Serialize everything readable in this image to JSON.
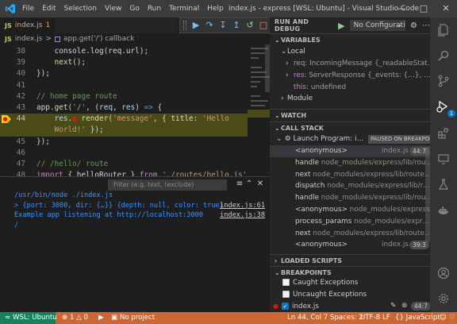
{
  "window": {
    "title": "index.js - express [WSL: Ubuntu] - Visual Studio Code",
    "menu": [
      "File",
      "Edit",
      "Selection",
      "View",
      "Go",
      "Run",
      "Terminal",
      "Help"
    ]
  },
  "editor": {
    "tab": {
      "filename": "index.js",
      "problems": "1"
    },
    "breadcrumb": {
      "file": "index.js",
      "separator": ">",
      "symbol": "app.get('/') callback"
    },
    "current_line": 44,
    "lines": [
      {
        "n": "38",
        "parts": [
          [
            "plain",
            "    console.log(req.url);"
          ]
        ]
      },
      {
        "n": "39",
        "parts": [
          [
            "plain",
            "    "
          ],
          [
            "fn",
            "next"
          ],
          [
            "plain",
            "();"
          ]
        ]
      },
      {
        "n": "40",
        "parts": [
          [
            "plain",
            "});"
          ]
        ]
      },
      {
        "n": "41",
        "parts": [
          [
            "plain",
            ""
          ]
        ]
      },
      {
        "n": "42",
        "parts": [
          [
            "cm",
            "// home page route"
          ]
        ]
      },
      {
        "n": "43",
        "parts": [
          [
            "plain",
            "app."
          ],
          [
            "fn",
            "get"
          ],
          [
            "plain",
            "("
          ],
          [
            "str",
            "'/'"
          ],
          [
            "plain",
            ", ("
          ],
          [
            "var",
            "req"
          ],
          [
            "plain",
            ", "
          ],
          [
            "var",
            "res"
          ],
          [
            "plain",
            ") "
          ],
          [
            "kw2",
            "=>"
          ],
          [
            "plain",
            " {"
          ]
        ]
      },
      {
        "n": "44",
        "parts": [
          [
            "plain",
            "    "
          ],
          [
            "var",
            "res"
          ],
          [
            "plain",
            "."
          ],
          [
            "bp",
            "●"
          ],
          [
            "plain",
            " "
          ],
          [
            "fn",
            "render"
          ],
          [
            "plain",
            "("
          ],
          [
            "str",
            "'message'"
          ],
          [
            "plain",
            ", { title: "
          ],
          [
            "str",
            "'Hello"
          ]
        ]
      },
      {
        "n": "",
        "parts": [
          [
            "str",
            "    World!'"
          ],
          [
            "plain",
            " });"
          ]
        ]
      },
      {
        "n": "45",
        "parts": [
          [
            "plain",
            "});"
          ]
        ]
      },
      {
        "n": "46",
        "parts": [
          [
            "plain",
            ""
          ]
        ]
      },
      {
        "n": "47",
        "parts": [
          [
            "cm",
            "// /hello/ route"
          ]
        ]
      },
      {
        "n": "48",
        "parts": [
          [
            "kw",
            "import"
          ],
          [
            "plain",
            " { helloRouter } "
          ],
          [
            "kw",
            "from"
          ],
          [
            "plain",
            " "
          ],
          [
            "str",
            "'./routes/hello.js'"
          ],
          [
            "plain",
            ";"
          ]
        ]
      },
      {
        "n": "49",
        "parts": [
          [
            "plain",
            "app."
          ],
          [
            "fn",
            "use"
          ],
          [
            "plain",
            "("
          ],
          [
            "str",
            "'/hello'"
          ],
          [
            "plain",
            ", helloRouter);"
          ]
        ]
      }
    ]
  },
  "console": {
    "filter_placeholder": "Filter (e.g. text, !exclude)",
    "lines": [
      {
        "text": "/usr/bin/node ./index.js",
        "color": "#3794ff",
        "ref": ""
      },
      {
        "text": "> {port: 3000, dir: {…}} {depth: null, color: true}",
        "color": "#3794ff",
        "ref": "index.js:61"
      },
      {
        "text": "Example app listening at http://localhost:3000",
        "color": "#3794ff",
        "ref": "index.js:38"
      },
      {
        "text": "/",
        "color": "#3794ff",
        "ref": ""
      }
    ]
  },
  "debug": {
    "run_label": "RUN AND DEBUG",
    "config": "No Configurati",
    "variables": {
      "title": "VARIABLES",
      "local": "Local",
      "items": [
        {
          "name": "req:",
          "value": "IncomingMessage {_readableStat…"
        },
        {
          "name": "res:",
          "value": "ServerResponse {_events: {…}, …"
        },
        {
          "name": "this:",
          "value": "undefined"
        }
      ],
      "module": "Module"
    },
    "watch": "WATCH",
    "call_stack": {
      "title": "CALL STACK",
      "thread": "Launch Program: i…",
      "paused": "PAUSED ON BREAKPOINT",
      "frames": [
        {
          "name": "<anonymous>",
          "src": "",
          "file": "index.js",
          "pos": "44:7",
          "selected": true
        },
        {
          "name": "handle",
          "src": "node_modules/express/lib/rou…",
          "file": "",
          "pos": "",
          "selected": false
        },
        {
          "name": "next",
          "src": "node_modules/express/lib/route…",
          "file": "",
          "pos": "",
          "selected": false
        },
        {
          "name": "dispatch",
          "src": "node_modules/express/lib/r…",
          "file": "",
          "pos": "",
          "selected": false
        },
        {
          "name": "handle",
          "src": "node_modules/express/lib/rou…",
          "file": "",
          "pos": "",
          "selected": false
        },
        {
          "name": "<anonymous>",
          "src": "node_modules/express/li…",
          "file": "",
          "pos": "",
          "selected": false
        },
        {
          "name": "process_params",
          "src": "node_modules/expr…",
          "file": "",
          "pos": "",
          "selected": false
        },
        {
          "name": "next",
          "src": "node_modules/express/lib/route…",
          "file": "",
          "pos": "",
          "selected": false
        },
        {
          "name": "<anonymous>",
          "src": "",
          "file": "index.js",
          "pos": "39:3",
          "selected": false
        }
      ]
    },
    "loaded_scripts": "LOADED SCRIPTS",
    "breakpoints": {
      "title": "BREAKPOINTS",
      "items": [
        {
          "label": "Caught Exceptions",
          "checked": false,
          "pos": ""
        },
        {
          "label": "Uncaught Exceptions",
          "checked": false,
          "pos": ""
        },
        {
          "label": "index.js",
          "checked": true,
          "pos": "44:7"
        }
      ]
    }
  },
  "activity": {
    "debug_badge": "1"
  },
  "status": {
    "remote": "WSL: Ubuntu",
    "errors": "1",
    "warnings": "0",
    "project": "No project",
    "cursor": "Ln 44, Col 7",
    "spaces": "Spaces: 2",
    "encoding": "UTF-8",
    "eol": "LF",
    "language": "JavaScript"
  },
  "colors": {
    "status_debug": "#cc6633",
    "remote": "#16825d",
    "accent": "#007acc",
    "highlight_line": "#4b4b18"
  }
}
